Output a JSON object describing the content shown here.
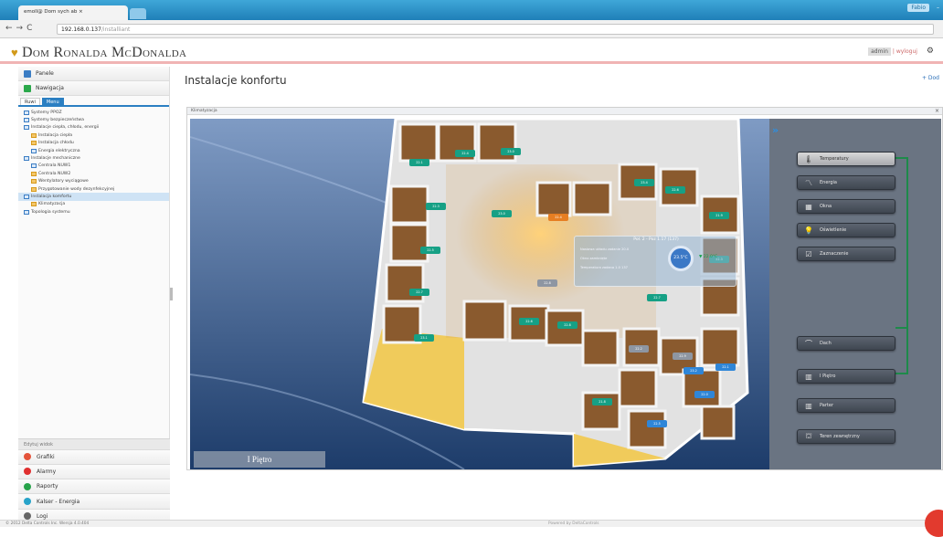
{
  "browser": {
    "tab_title": "emoll@ Dom sych ab",
    "url_host": "192.168.0.137",
    "url_path": "/installiant",
    "user_chip": "Fabio",
    "back": "←",
    "forward": "→",
    "reload": "C"
  },
  "header": {
    "brand": "Dom Ronalda McDonalda",
    "user_box": "admin",
    "links": "| wyloguj",
    "gear": "⚙"
  },
  "sidebar": {
    "panels": [
      {
        "label": "Panele"
      },
      {
        "label": "Nawigacja"
      }
    ],
    "tabs": [
      {
        "label": "Ruwi"
      },
      {
        "label": "Menu"
      }
    ],
    "tree": [
      {
        "label": "Systemy PPOZ"
      },
      {
        "label": "Systemy bezpieczeństwa"
      },
      {
        "label": "Instalacje ciepła, chłodu, energii"
      },
      {
        "label": "Instalacja ciepła"
      },
      {
        "label": "Instalacja chłodu"
      },
      {
        "label": "Energia elektryczna"
      },
      {
        "label": "Instalacje mechaniczne"
      },
      {
        "label": "Centrala NUW1"
      },
      {
        "label": "Centrala NUW2"
      },
      {
        "label": "Wentylatory wyciągowe"
      },
      {
        "label": "Przygotowanie wody dezynfekcyjnej"
      },
      {
        "label": "Instalacja komfortu"
      },
      {
        "label": "Klimatyzacja"
      },
      {
        "label": "Topologia systemu"
      }
    ],
    "bottom_caption": "Edytuj widok",
    "bottom": [
      {
        "label": "Grafiki",
        "color": "#e4533a"
      },
      {
        "label": "Alarmy",
        "color": "#e02f2f"
      },
      {
        "label": "Raporty",
        "color": "#27a34a"
      },
      {
        "label": "Kalser - Energia",
        "color": "#27a3c9"
      },
      {
        "label": "Logi",
        "color": "#666666"
      }
    ]
  },
  "main": {
    "title": "Instalacje konfortu",
    "add_link": "+ Dod",
    "panel_title": "Klimatyzacja",
    "panel_close": "×"
  },
  "floorplan": {
    "floor_label": "I Piętro",
    "room_info": {
      "title": "Poł. 2 - Poz 1.17 (137)",
      "lines": [
        "Nastawa układu zadanie 20.0",
        "Okno zamknięte",
        "Temperatura zadana 1.0 137"
      ],
      "gauge_value": "23.5°C",
      "setpoint": "▼ 22.0°C"
    },
    "badges": [
      "22.1",
      "22.4",
      "23.0",
      "22.3",
      "22.5",
      "22.7",
      "23.1",
      "22.6",
      "22.8",
      "22.2",
      "22.9",
      "23.2",
      "22.0",
      "21.8",
      "22.5",
      "22.1",
      "23.4",
      "22.6",
      "21.9",
      "22.3",
      "22.7",
      "23.0",
      "22.4",
      "22.8"
    ]
  },
  "right_panel": {
    "expand": "»",
    "buttons": [
      {
        "label": "Temperatury",
        "icon": "🌡"
      },
      {
        "label": "Energia",
        "icon": "〽"
      },
      {
        "label": "Okna",
        "icon": "▦"
      },
      {
        "label": "Oświetlenie",
        "icon": "💡"
      },
      {
        "label": "Zaznaczenie",
        "icon": "☑"
      },
      {
        "label": "Dach",
        "icon": "⌒"
      },
      {
        "label": "I Piętro",
        "icon": "▥"
      },
      {
        "label": "Parter",
        "icon": "▥"
      },
      {
        "label": "Teren zewnętrzny",
        "icon": "⛫"
      }
    ]
  },
  "status": {
    "left": "© 2012 Delta Controls Inc. Wersja 4.0.404",
    "mid": "Powered by DeltaControls"
  },
  "colors": {
    "accent": "#2b7fc2",
    "header_rule": "#f0b4b4",
    "connector": "#1e8a4a"
  }
}
